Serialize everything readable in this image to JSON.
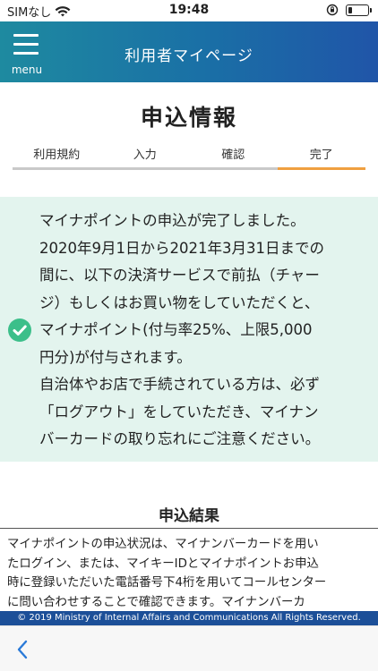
{
  "status_bar": {
    "carrier": "SIMなし",
    "time": "19:48",
    "battery_level": 0.2
  },
  "header": {
    "menu_label": "menu",
    "title": "利用者マイページ"
  },
  "page": {
    "title": "申込情報"
  },
  "steps": [
    {
      "label": "利用規約",
      "active": false
    },
    {
      "label": "入力",
      "active": false
    },
    {
      "label": "確認",
      "active": false
    },
    {
      "label": "完了",
      "active": true
    }
  ],
  "completion": {
    "message": "マイナポイントの申込が完了しました。\n2020年9月1日から2021年3月31日までの\n間に、以下の決済サービスで前払（チャー\nジ）もしくはお買い物をしていただくと、\nマイナポイント(付与率25%、上限5,000\n円分)が付与されます。\n自治体やお店で手続されている方は、必ず\n「ログアウト」をしていただき、マイナン\nバーカードの取り忘れにご注意ください。",
    "icon": "check-circle-icon"
  },
  "result": {
    "title": "申込結果",
    "text": "マイナポイントの申込状況は、マイナンバーカードを用い\nたログイン、または、マイキーIDとマイナポイントお申込\n時に登録いただいた電話番号下4桁を用いてコールセンター\nに問い合わせすることで確認できます。マイナンバーカ"
  },
  "footer": {
    "copyright": "© 2019 Ministry of Internal Affairs and Communications All Rights Reserved."
  },
  "colors": {
    "header_gradient": [
      "#1e8aa0",
      "#2055a8"
    ],
    "step_active": "#f0a040",
    "step_inactive": "#c9c9c9",
    "success_bg": "#e3f4ee",
    "check_green": "#3cbf8a",
    "footer_bg": "#1c4f98",
    "back_arrow": "#2a7ad8"
  }
}
